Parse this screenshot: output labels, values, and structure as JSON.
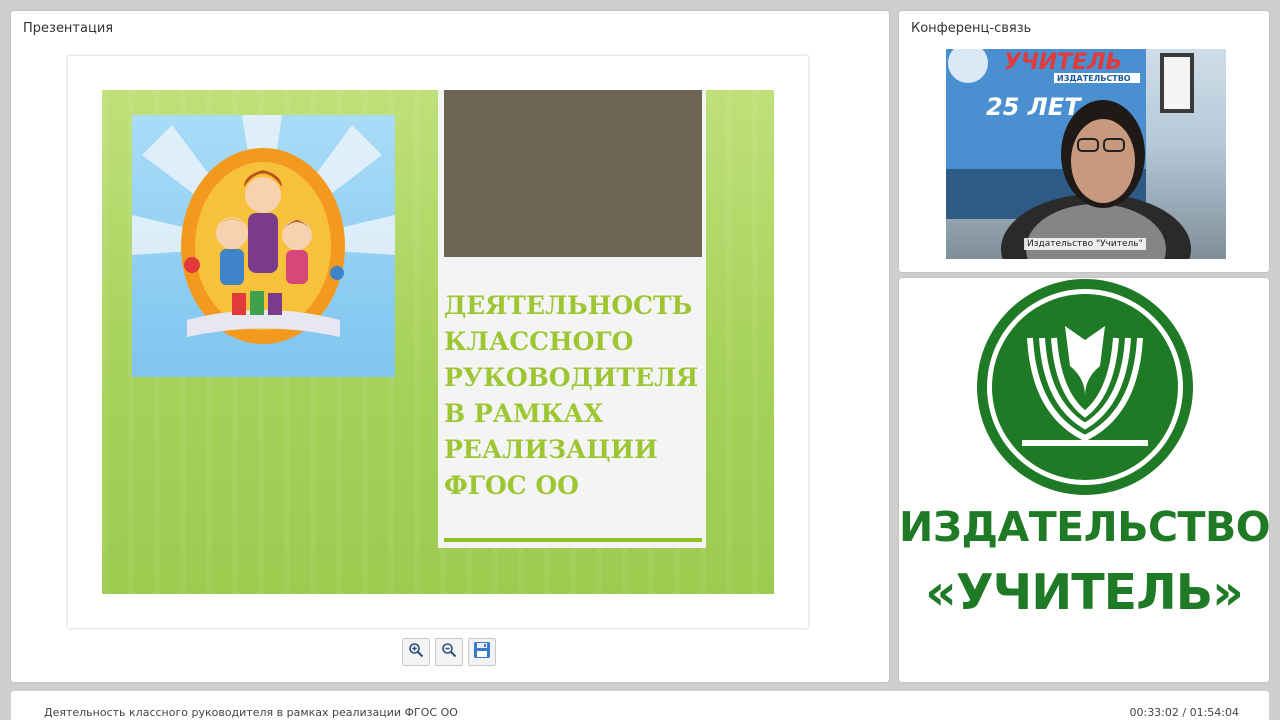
{
  "presentation_panel": {
    "title": "Презентация"
  },
  "slide": {
    "heading": "ДЕЯТЕЛЬНОСТЬ КЛАССНОГО РУКОВОДИТЕЛЯ В РАМКАХ РЕАЛИЗАЦИИ ФГОС ОО",
    "colors": {
      "background": "#a6d25a",
      "heading": "#9cc733",
      "card_top": "#6d6453"
    }
  },
  "toolbar": {
    "zoom_in_icon": "zoom-in-icon",
    "zoom_out_icon": "zoom-out-icon",
    "save_icon": "floppy-disk-icon"
  },
  "conference_panel": {
    "title": "Конференц-связь",
    "video_label": "Издательство \"Учитель\"",
    "banner": {
      "word": "УЧИТЕЛЬ",
      "sub": "ИЗДАТЕЛЬСТВО",
      "years": "25 ЛЕТ"
    }
  },
  "publisher": {
    "name": "ИЗДАТЕЛЬСТВО",
    "brand": "«УЧИТЕЛЬ»",
    "color": "#1f7a25"
  },
  "footer": {
    "title": "Деятельность классного руководителя в рамках реализации ФГОС ОО",
    "time": "00:33:02 / 01:54:04"
  }
}
